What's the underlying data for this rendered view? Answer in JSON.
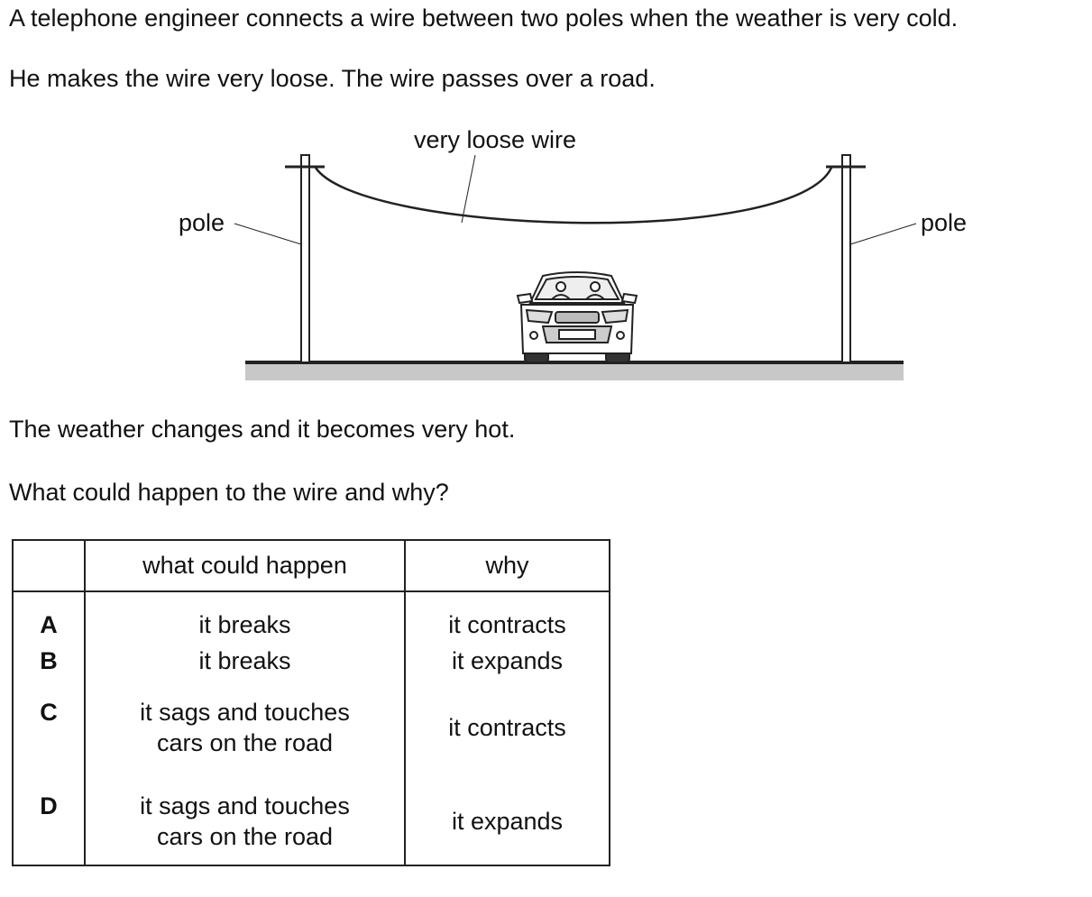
{
  "question": {
    "intro_line_1": "A telephone engineer connects a wire between two poles when the weather is very cold.",
    "intro_line_2": "He makes the wire very loose. The wire passes over a road.",
    "change_line": "The weather changes and it becomes very hot.",
    "prompt_line": "What could happen to the wire and why?"
  },
  "diagram": {
    "wire_label": "very loose wire",
    "left_pole_label": "pole",
    "right_pole_label": "pole",
    "colors": {
      "line": "#222222",
      "road": "#c8c8c8"
    },
    "icons": [
      "car-icon"
    ]
  },
  "table": {
    "headers": {
      "letter": "",
      "what": "what could happen",
      "why": "why"
    },
    "rows": [
      {
        "letter": "A",
        "what_1": "it breaks",
        "what_2": "",
        "why": "it contracts"
      },
      {
        "letter": "B",
        "what_1": "it breaks",
        "what_2": "",
        "why": "it expands"
      },
      {
        "letter": "C",
        "what_1": "it sags and touches",
        "what_2": "cars on the road",
        "why": "it contracts"
      },
      {
        "letter": "D",
        "what_1": "it sags and touches",
        "what_2": "cars on the road",
        "why": "it expands"
      }
    ]
  }
}
